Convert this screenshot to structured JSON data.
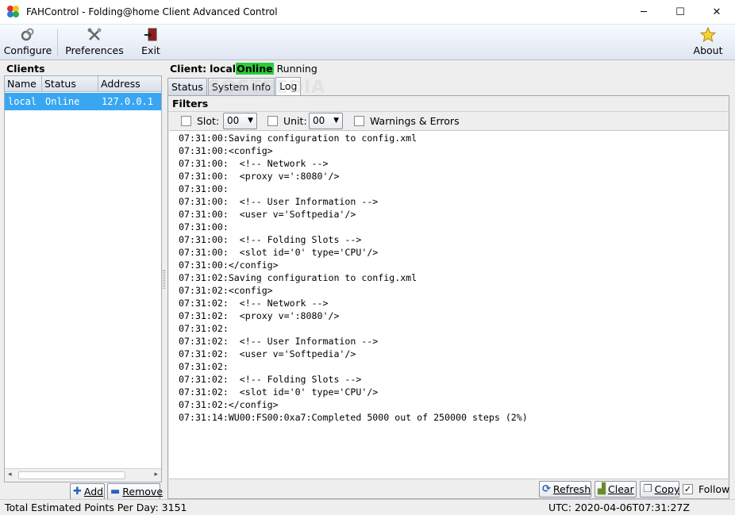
{
  "window": {
    "title": "FAHControl - Folding@home Client Advanced Control",
    "minimize_glyph": "─",
    "maximize_glyph": "☐",
    "close_glyph": "✕"
  },
  "toolbar": {
    "configure_label": "Configure",
    "preferences_label": "Preferences",
    "exit_label": "Exit",
    "about_label": "About"
  },
  "clients": {
    "title": "Clients",
    "columns": [
      "Name",
      "Status",
      "Address"
    ],
    "rows": [
      {
        "name": "local",
        "status": "Online",
        "address": "127.0.0.1"
      }
    ],
    "add_label": "Add",
    "remove_label": "Remove"
  },
  "client": {
    "label": "Client:",
    "name": "local",
    "status": "Online",
    "state": "Running"
  },
  "tabs": [
    "Status",
    "System Info",
    "Log"
  ],
  "watermark": "SOFTPEDIA",
  "filters": {
    "title": "Filters",
    "slot_label": "Slot:",
    "slot_value": "00",
    "unit_label": "Unit:",
    "unit_value": "00",
    "warnings_label": "Warnings & Errors"
  },
  "log_lines": [
    "07:31:00:Saving configuration to config.xml",
    "07:31:00:<config>",
    "07:31:00:  <!-- Network -->",
    "07:31:00:  <proxy v=':8080'/>",
    "07:31:00:",
    "07:31:00:  <!-- User Information -->",
    "07:31:00:  <user v='Softpedia'/>",
    "07:31:00:",
    "07:31:00:  <!-- Folding Slots -->",
    "07:31:00:  <slot id='0' type='CPU'/>",
    "07:31:00:</config>",
    "07:31:02:Saving configuration to config.xml",
    "07:31:02:<config>",
    "07:31:02:  <!-- Network -->",
    "07:31:02:  <proxy v=':8080'/>",
    "07:31:02:",
    "07:31:02:  <!-- User Information -->",
    "07:31:02:  <user v='Softpedia'/>",
    "07:31:02:",
    "07:31:02:  <!-- Folding Slots -->",
    "07:31:02:  <slot id='0' type='CPU'/>",
    "07:31:02:</config>",
    "07:31:14:WU00:FS00:0xa7:Completed 5000 out of 250000 steps (2%)"
  ],
  "log_buttons": {
    "refresh_label": "Refresh",
    "clear_label": "Clear",
    "copy_label": "Copy",
    "follow_label": "Follow",
    "follow_checked": true
  },
  "statusbar": {
    "points": "Total Estimated Points Per Day: 3151",
    "utc": "UTC: 2020-04-06T07:31:27Z"
  },
  "colors": {
    "selection": "#39a6f2",
    "online_badge": "#2ecc3a",
    "toolbar_top": "#f8fbff",
    "toolbar_bottom": "#dfe6f2"
  }
}
